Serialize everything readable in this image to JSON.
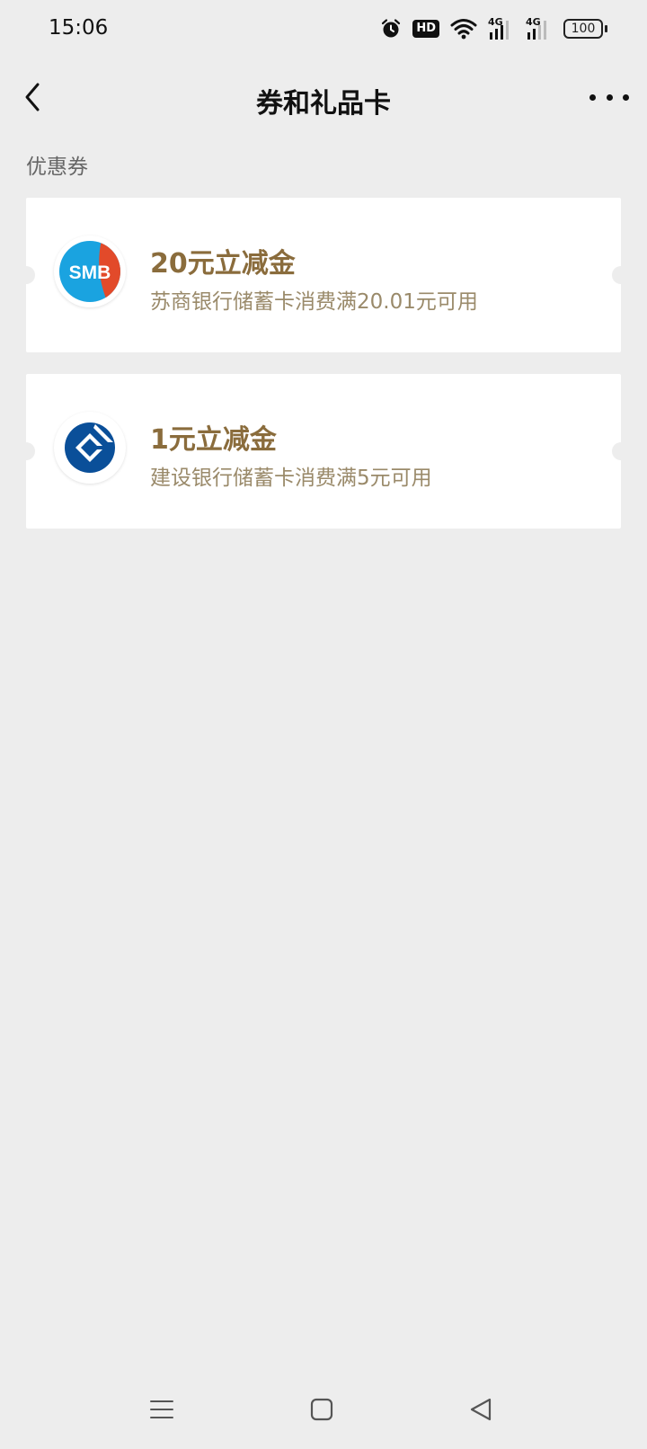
{
  "status_bar": {
    "time": "15:06",
    "hd_label": "HD",
    "signal1_label": "4G",
    "signal2_label": "4G",
    "battery": "100",
    "icons": [
      "alarm-icon",
      "hd-icon",
      "wifi-icon",
      "signal-4g-icon",
      "signal-4g-icon",
      "battery-icon"
    ]
  },
  "header": {
    "title": "券和礼品卡",
    "back_icon": "chevron-left-icon",
    "more_icon": "more-dots-icon"
  },
  "section": {
    "label": "优惠券"
  },
  "coupons": [
    {
      "logo_text": "SMB",
      "title": "20元立减金",
      "description": "苏商银行储蓄卡消费满20.01元可用"
    },
    {
      "logo_text": "",
      "title": "1元立减金",
      "description": "建设银行储蓄卡消费满5元可用"
    }
  ],
  "system_nav": {
    "icons": [
      "menu-icon",
      "home-icon",
      "back-triangle-icon"
    ]
  },
  "colors": {
    "background": "#ededed",
    "card": "#ffffff",
    "coupon_title": "#8a6c3c",
    "coupon_desc": "#9a8a6a",
    "smb_blue": "#1aa3e0",
    "smb_red": "#e24a2a",
    "ccb_blue": "#0a4f99"
  }
}
